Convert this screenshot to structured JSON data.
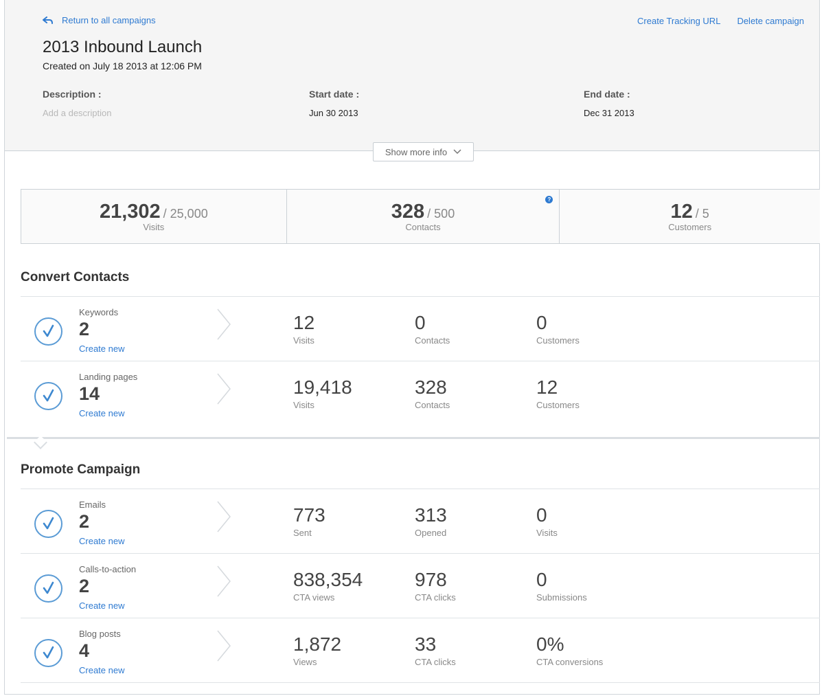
{
  "header": {
    "back_label": "Return to all campaigns",
    "actions": [
      "Create Tracking URL",
      "Delete campaign"
    ],
    "title": "2013 Inbound Launch",
    "created": "Created on July 18 2013 at 12:06 PM",
    "description_label": "Description :",
    "description_placeholder": "Add a description",
    "start_label": "Start date :",
    "start_value": "Jun 30 2013",
    "end_label": "End date :",
    "end_value": "Dec 31 2013",
    "show_more_label": "Show more info"
  },
  "summary": [
    {
      "value": "21,302",
      "goal": "/ 25,000",
      "label": "Visits"
    },
    {
      "value": "328",
      "goal": "/ 500",
      "label": "Contacts",
      "help": "?"
    },
    {
      "value": "12",
      "goal": "/ 5",
      "label": "Customers"
    }
  ],
  "sections": {
    "convert_title": "Convert Contacts",
    "promote_title": "Promote Campaign"
  },
  "create_new": "Create new",
  "rows": [
    {
      "name": "Keywords",
      "count": "2",
      "stats": [
        {
          "num": "12",
          "cap": "Visits"
        },
        {
          "num": "0",
          "cap": "Contacts"
        },
        {
          "num": "0",
          "cap": "Customers"
        }
      ]
    },
    {
      "name": "Landing pages",
      "count": "14",
      "stats": [
        {
          "num": "19,418",
          "cap": "Visits"
        },
        {
          "num": "328",
          "cap": "Contacts"
        },
        {
          "num": "12",
          "cap": "Customers"
        }
      ]
    },
    {
      "name": "Emails",
      "count": "2",
      "stats": [
        {
          "num": "773",
          "cap": "Sent"
        },
        {
          "num": "313",
          "cap": "Opened"
        },
        {
          "num": "0",
          "cap": "Visits"
        }
      ]
    },
    {
      "name": "Calls-to-action",
      "count": "2",
      "stats": [
        {
          "num": "838,354",
          "cap": "CTA views"
        },
        {
          "num": "978",
          "cap": "CTA clicks"
        },
        {
          "num": "0",
          "cap": "Submissions"
        }
      ]
    },
    {
      "name": "Blog posts",
      "count": "4",
      "stats": [
        {
          "num": "1,872",
          "cap": "Views"
        },
        {
          "num": "33",
          "cap": "CTA clicks"
        },
        {
          "num": "0%",
          "cap": "CTA conversions"
        }
      ]
    }
  ],
  "colors": {
    "link": "#2e7ad1",
    "check": "#5a9bd5",
    "header_bg": "#f5f5f5"
  }
}
